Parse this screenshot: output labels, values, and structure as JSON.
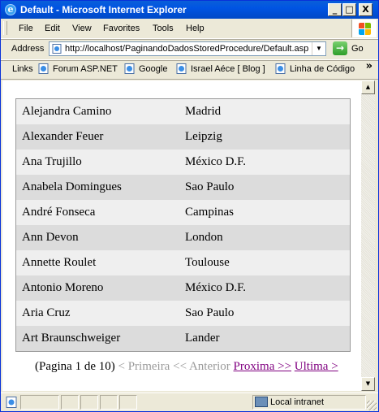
{
  "window": {
    "title": "Default - Microsoft Internet Explorer",
    "minimize": "_",
    "maximize": "□",
    "close": "X"
  },
  "menu": {
    "items": [
      {
        "label": "File"
      },
      {
        "label": "Edit"
      },
      {
        "label": "View"
      },
      {
        "label": "Favorites"
      },
      {
        "label": "Tools"
      },
      {
        "label": "Help"
      }
    ]
  },
  "address": {
    "label": "Address",
    "url": "http://localhost/PaginandoDadosStoredProcedure/Default.aspx",
    "go_label": "Go"
  },
  "links": {
    "label": "Links",
    "items": [
      {
        "label": "Forum ASP.NET"
      },
      {
        "label": "Google"
      },
      {
        "label": "Israel Aéce [ Blog ]"
      },
      {
        "label": "Linha de Código"
      }
    ],
    "more": "»"
  },
  "grid": {
    "rows": [
      {
        "name": "Alejandra Camino",
        "city": "Madrid"
      },
      {
        "name": "Alexander Feuer",
        "city": "Leipzig"
      },
      {
        "name": "Ana Trujillo",
        "city": "México D.F."
      },
      {
        "name": "Anabela Domingues",
        "city": "Sao Paulo"
      },
      {
        "name": "André Fonseca",
        "city": "Campinas"
      },
      {
        "name": "Ann Devon",
        "city": "London"
      },
      {
        "name": "Annette Roulet",
        "city": "Toulouse"
      },
      {
        "name": "Antonio Moreno",
        "city": "México D.F."
      },
      {
        "name": "Aria Cruz",
        "city": "Sao Paulo"
      },
      {
        "name": "Art Braunschweiger",
        "city": "Lander"
      }
    ]
  },
  "pager": {
    "info": "(Pagina 1 de 10)",
    "first": "< Primeira",
    "prev": "<< Anterior",
    "next": "Proxima >>",
    "last": "Ultima >"
  },
  "status": {
    "zone": "Local intranet"
  },
  "colors": {
    "titlebar": "#0054E3",
    "link_visited": "#800080",
    "disabled_link": "#9A9A9A",
    "row_odd": "#EFEFEF",
    "row_even": "#DCDCDC"
  }
}
